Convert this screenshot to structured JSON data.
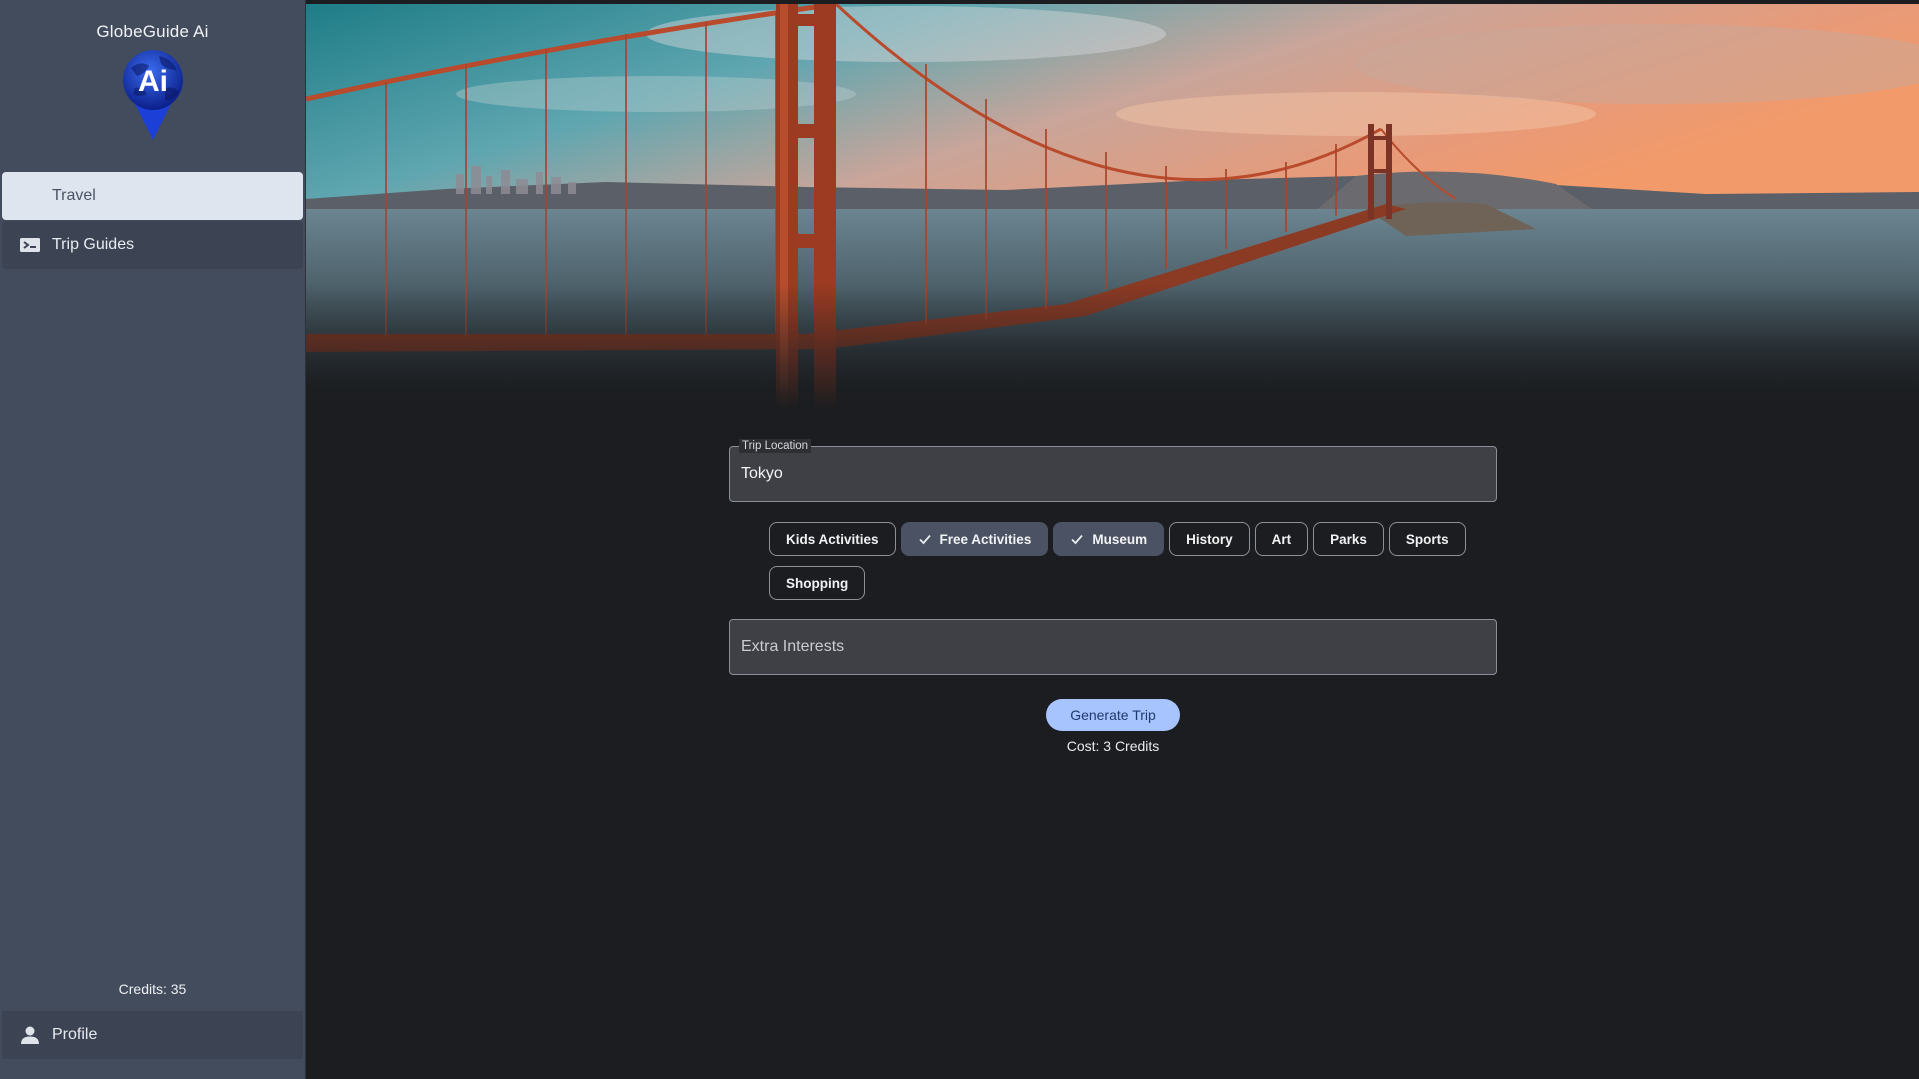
{
  "app": {
    "title": "GlobeGuide Ai",
    "logo_text": "Ai"
  },
  "sidebar": {
    "items": [
      {
        "label": "Travel",
        "active": true
      },
      {
        "label": "Trip Guides",
        "active": false
      }
    ],
    "credits": "Credits: 35",
    "profile_label": "Profile"
  },
  "form": {
    "location": {
      "legend": "Trip Location",
      "value": "Tokyo"
    },
    "interests": [
      {
        "label": "Kids Activities",
        "selected": false
      },
      {
        "label": "Free Activities",
        "selected": true
      },
      {
        "label": "Museum",
        "selected": true
      },
      {
        "label": "History",
        "selected": false
      },
      {
        "label": "Art",
        "selected": false
      },
      {
        "label": "Parks",
        "selected": false
      },
      {
        "label": "Sports",
        "selected": false
      },
      {
        "label": "Shopping",
        "selected": false
      }
    ],
    "extra": {
      "placeholder": "Extra Interests",
      "value": ""
    },
    "generate_label": "Generate Trip",
    "cost": "Cost: 3 Credits"
  },
  "colors": {
    "sidebar_bg": "#434c5c",
    "active_item_bg": "#dfe5ee",
    "main_bg": "#1b1d20",
    "primary_button": "#a8c4ff",
    "selected_chip": "#4a5263"
  },
  "icons": {
    "logo": "location-pin-globe-icon",
    "trip_guides": "ticket-icon",
    "profile": "person-icon",
    "selected_chip": "check-icon"
  },
  "hero": {
    "subject": "golden-gate-bridge-photo"
  }
}
